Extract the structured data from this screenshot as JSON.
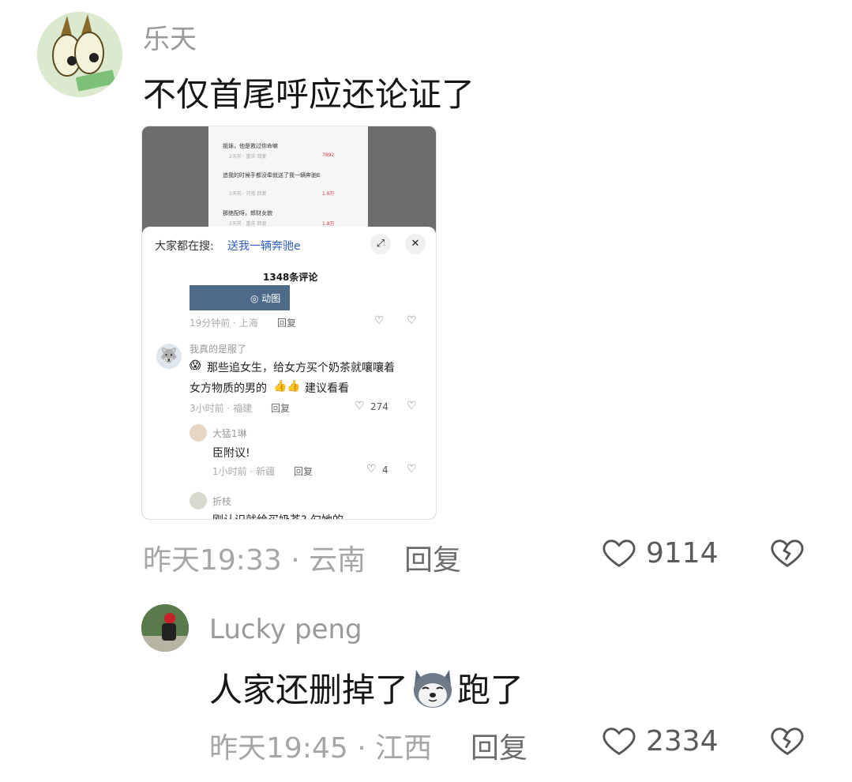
{
  "comments": [
    {
      "username": "乐天",
      "text": "不仅首尾呼应还论证了",
      "time_location": "昨天19:33 · 云南",
      "reply_label": "回复",
      "likes": "9114",
      "avatar_icon": "cartoon-eyes-money-avatar-icon",
      "embedded_screenshot": {
        "top_comments": [
          {
            "text": "姐妹，他是救过你命嘛",
            "meta": "2天前 · 重庆  回复",
            "likes": "7892"
          },
          {
            "text": "追我的时候手都没牵就送了我一辆奔驰E",
            "meta": "2天前 · 河南  回复",
            "likes": "1.6万"
          },
          {
            "text": "那绝配呀，郎财女貌",
            "meta": "2天前 · 重庆  回复",
            "likes": "1.8万"
          }
        ],
        "search_prefix": "大家都在搜:",
        "search_term": "送我一辆奔驰e",
        "comment_count": "1348条评论",
        "gif_label": "◎ 动图",
        "first_meta": "19分钟前 · 上海",
        "first_reply": "回复",
        "c1_user": "我真的是服了",
        "c1_line1": "那些追女生，给女方买个奶茶就嚷嚷着",
        "c1_line2a": "女方物质的男的",
        "c1_line2b": "建议看看",
        "c1_meta": "3小时前 · 福建",
        "c1_reply": "回复",
        "c1_likes": "274",
        "c2_user": "大猛1琳",
        "c2_text": "臣附议!",
        "c2_meta": "1小时前 · 新疆",
        "c2_reply": "回复",
        "c2_likes": "4",
        "c3_user": "折枝",
        "c3_text": "刚认识就给买奶茶? 勾她的"
      }
    },
    {
      "username": "Lucky peng",
      "text_before": "人家还删掉了",
      "emoji": "husky-dog-emoji",
      "text_after": "跑了",
      "time_location": "昨天19:45 · 江西",
      "reply_label": "回复",
      "likes": "2334",
      "avatar_icon": "person-red-hat-avatar-icon"
    }
  ],
  "colors": {
    "text": "#161616",
    "username": "#9a9a9a",
    "meta": "#a6a6a6",
    "accent_link": "#2f5fbf",
    "heart": "#e03a4a"
  }
}
